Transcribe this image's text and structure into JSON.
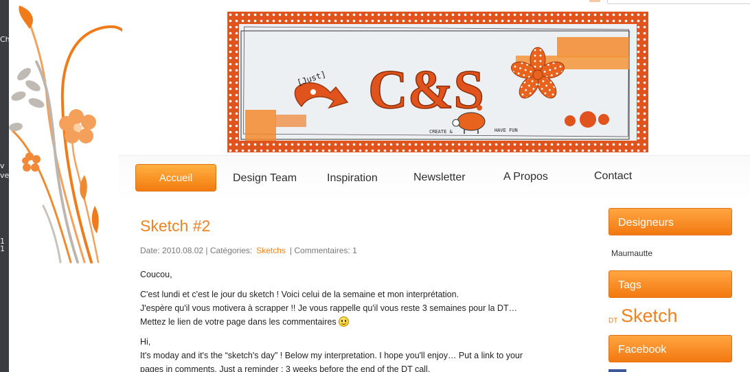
{
  "left_strip": {
    "fragments": [
      "Ch",
      "v",
      "ve",
      "1 1"
    ]
  },
  "nav": {
    "items": [
      "Accueil",
      "Design Team",
      "Inspiration",
      "Newsletter",
      "A Propos",
      "Contact"
    ],
    "active_index": 0
  },
  "banner": {
    "just_text": "[Just]",
    "title": "C&S",
    "create_text": "CREATE &",
    "havefun_text": "HAVE FUN"
  },
  "post": {
    "title": "Sketch #2",
    "meta_prefix": "Date: 2010.08.02 | Catégories:",
    "category": "Sketchs",
    "meta_suffix": "| Commentaires: 1",
    "greeting": "Coucou,",
    "fr_line1": "C'est lundi et c'est le jour du sketch ! Voici celui de la semaine et mon interprétation.",
    "fr_line2": "J'espère qu'il vous motivera à scrapper !! Je vous rappelle qu'il vous reste 3 semaines pour la DT…",
    "fr_line3": "Mettez le lien de votre page dans les commentaires",
    "en_greeting": "Hi,",
    "en_line1": "It's moday and it's the “sketch's day” ! Below my interpretation. I hope you'll enjoy… Put a link to your",
    "en_line2": "pages in comments. Just a reminder : 3 weeks before the end of the DT call."
  },
  "sidebar": {
    "designers_label": "Designeurs",
    "designer_name": "Maumautte",
    "tags_label": "Tags",
    "tag_small": "DT",
    "tag_large": "Sketch",
    "facebook_label": "Facebook"
  },
  "colors": {
    "accent": "#f0821e",
    "button": "#f37810",
    "banner_border": "#e0531c"
  }
}
